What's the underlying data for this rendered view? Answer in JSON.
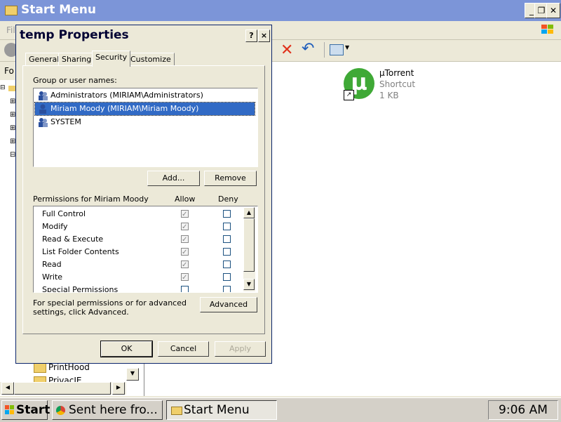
{
  "explorer": {
    "title": "Start Menu",
    "menu_first": "Fil",
    "fo_label": "Fo",
    "tree_items": [
      "PrintHood",
      "PrivacIE"
    ],
    "file": {
      "name": "µTorrent",
      "type": "Shortcut",
      "size": "1 KB"
    }
  },
  "dialog": {
    "title": "temp Properties",
    "help_btn": "?",
    "close_btn": "×",
    "tabs": [
      "General",
      "Sharing",
      "Security",
      "Customize"
    ],
    "group_label": "Group or user names:",
    "users": [
      "Administrators (MIRIAM\\Administrators)",
      "Miriam Moody (MIRIAM\\Miriam Moody)",
      "SYSTEM"
    ],
    "add_btn": "Add...",
    "remove_btn": "Remove",
    "permissions_label": "Permissions for Miriam Moody",
    "allow_label": "Allow",
    "deny_label": "Deny",
    "permissions": [
      "Full Control",
      "Modify",
      "Read & Execute",
      "List Folder Contents",
      "Read",
      "Write",
      "Special Permissions"
    ],
    "advanced_text": "For special permissions or for advanced settings, click Advanced.",
    "advanced_btn": "Advanced",
    "ok_btn": "OK",
    "cancel_btn": "Cancel",
    "apply_btn": "Apply"
  },
  "taskbar": {
    "start_label": "Start",
    "tasks": [
      "Sent here fro...",
      "Start Menu"
    ],
    "clock": "9:06 AM"
  },
  "colors": {
    "selection": "#316ac5",
    "title_bar": "#7c95d8",
    "utorrent_green": "#3fa936"
  }
}
